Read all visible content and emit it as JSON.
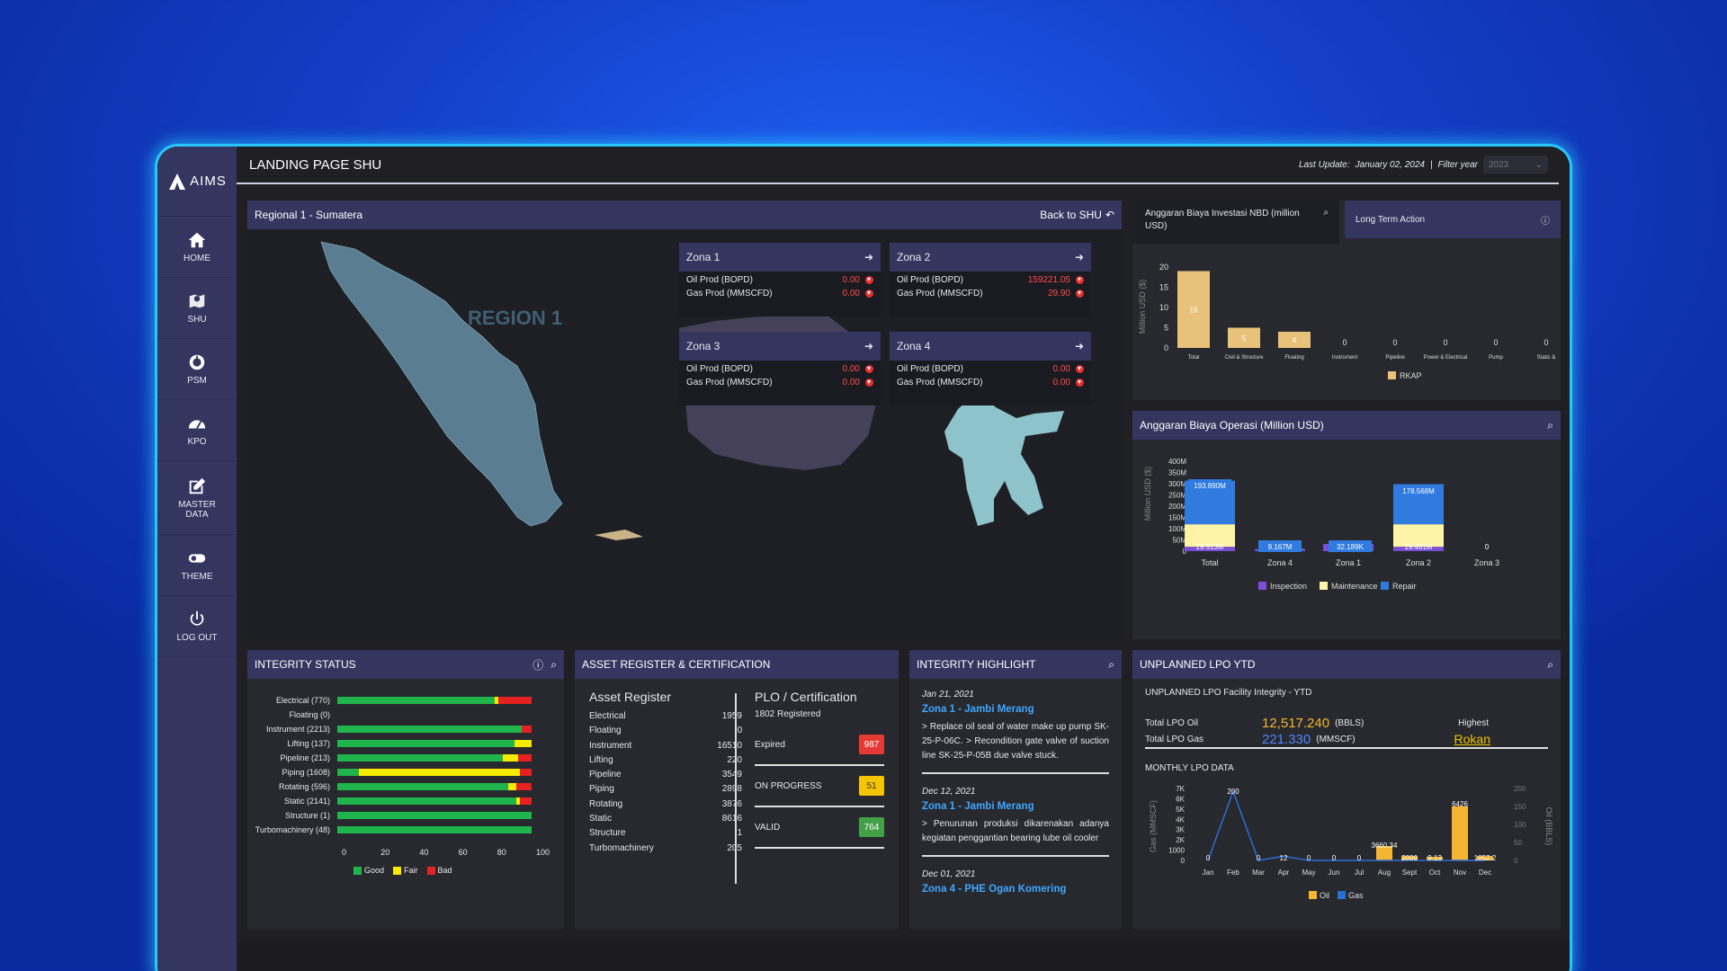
{
  "app": {
    "logo_text": "AIMS",
    "page_title": "LANDING PAGE SHU",
    "last_update_label": "Last Update:",
    "last_update_value": "January 02, 2024",
    "separator": "|",
    "filter_label": "Filter year",
    "filter_value": "2023"
  },
  "sidebar": {
    "items": [
      {
        "label": "HOME",
        "icon": "home-icon"
      },
      {
        "label": "SHU",
        "icon": "map-pin-icon"
      },
      {
        "label": "PSM",
        "icon": "dashboard-icon"
      },
      {
        "label": "KPO",
        "icon": "gauge-icon"
      },
      {
        "label": "MASTER DATA",
        "icon": "edit-icon"
      },
      {
        "label": "THEME",
        "icon": "toggle-icon"
      },
      {
        "label": "LOG OUT",
        "icon": "power-icon"
      }
    ]
  },
  "map": {
    "header": "Regional 1 - Sumatera",
    "back_label": "Back to SHU",
    "region_label": "REGION 1",
    "zones": [
      {
        "name": "Zona 1",
        "oil_label": "Oil Prod (BOPD)",
        "oil": "0.00",
        "gas_label": "Gas Prod (MMSCFD)",
        "gas": "0.00"
      },
      {
        "name": "Zona 2",
        "oil_label": "Oil Prod (BOPD)",
        "oil": "159221.05",
        "gas_label": "Gas Prod (MMSCFD)",
        "gas": "29.90"
      },
      {
        "name": "Zona 3",
        "oil_label": "Oil Prod (BOPD)",
        "oil": "0.00",
        "gas_label": "Gas Prod (MMSCFD)",
        "gas": "0.00"
      },
      {
        "name": "Zona 4",
        "oil_label": "Oil Prod (BOPD)",
        "oil": "0.00",
        "gas_label": "Gas Prod (MMSCFD)",
        "gas": "0.00"
      }
    ]
  },
  "invest": {
    "title": "Anggaran Biaya Investasi NBD (million USD)",
    "long_term": "Long Term Action"
  },
  "ops": {
    "title": "Anggaran Biaya Operasi (Million USD)"
  },
  "integrity": {
    "title": "INTEGRITY STATUS",
    "legend": [
      "Good",
      "Fair",
      "Bad"
    ],
    "ticks": [
      "0",
      "20",
      "40",
      "60",
      "80",
      "100"
    ],
    "rows": [
      {
        "label": "Electrical (770)",
        "good": 81,
        "fair": 2,
        "bad": 17
      },
      {
        "label": "Floating (0)",
        "good": 0,
        "fair": 0,
        "bad": 0
      },
      {
        "label": "Instrument (2213)",
        "good": 95,
        "fair": 0,
        "bad": 5
      },
      {
        "label": "Lifting (137)",
        "good": 91,
        "fair": 9,
        "bad": 0
      },
      {
        "label": "Pipeline (213)",
        "good": 85,
        "fair": 8,
        "bad": 7
      },
      {
        "label": "Piping (1608)",
        "good": 11,
        "fair": 83,
        "bad": 6
      },
      {
        "label": "Rotating (596)",
        "good": 88,
        "fair": 4,
        "bad": 8
      },
      {
        "label": "Static (2141)",
        "good": 92,
        "fair": 2,
        "bad": 6
      },
      {
        "label": "Structure (1)",
        "good": 100,
        "fair": 0,
        "bad": 0
      },
      {
        "label": "Turbomachinery (48)",
        "good": 100,
        "fair": 0,
        "bad": 0
      }
    ]
  },
  "asset": {
    "title": "ASSET REGISTER & CERTIFICATION",
    "register_title": "Asset Register",
    "rows": [
      [
        "Electrical",
        "1959"
      ],
      [
        "Floating",
        "0"
      ],
      [
        "Instrument",
        "16510"
      ],
      [
        "Lifting",
        "220"
      ],
      [
        "Pipeline",
        "3549"
      ],
      [
        "Piping",
        "2898"
      ],
      [
        "Rotating",
        "3876"
      ],
      [
        "Static",
        "8616"
      ],
      [
        "Structure",
        "1"
      ],
      [
        "Turbomachinery",
        "205"
      ]
    ],
    "plo_title": "PLO / Certification",
    "registered": "1802 Registered",
    "cert": [
      {
        "label": "Expired",
        "value": "987",
        "color": "#e53935"
      },
      {
        "label": "ON PROGRESS",
        "value": "51",
        "color": "#f5c400"
      },
      {
        "label": "VALID",
        "value": "764",
        "color": "#43a047"
      }
    ]
  },
  "highlight": {
    "title": "INTEGRITY HIGHLIGHT",
    "items": [
      {
        "date": "Jan 21, 2021",
        "zone": "Zona 1 - Jambi Merang",
        "text": "> Replace oil seal of water make up pump SK-25-P-06C. > Recondition gate valve of suction line SK-25-P-05B due valve stuck."
      },
      {
        "date": "Dec 12, 2021",
        "zone": "Zona 1 - Jambi Merang",
        "text": "> Penurunan produksi dikarenakan adanya kegiatan penggantian bearing lube oil cooler"
      },
      {
        "date": "Dec 01, 2021",
        "zone": "Zona 4 - PHE Ogan Komering",
        "text": ""
      }
    ]
  },
  "lpo": {
    "title": "UNPLANNED LPO YTD",
    "subtitle": "UNPLANNED LPO Facility Integrity - YTD",
    "oil_label": "Total LPO Oil",
    "oil_value": "12,517.240",
    "oil_unit": "(BBLS)",
    "gas_label": "Total LPO Gas",
    "gas_value": "221.330",
    "gas_unit": "(MMSCF)",
    "highest_label": "Highest",
    "highest_value": "Rokan",
    "monthly_title": "MONTHLY LPO DATA"
  },
  "chart_data": [
    {
      "type": "bar",
      "title": "Anggaran Biaya Investasi NBD (million USD)",
      "ylabel": "Million USD ($)",
      "categories": [
        "Total",
        "Civil & Structure",
        "Floating",
        "Instrument",
        "Pipeline",
        "Power & Electrical",
        "Pump",
        "Static &"
      ],
      "series": [
        {
          "name": "RKAP",
          "values": [
            19,
            5,
            4,
            0,
            0,
            0,
            0,
            0
          ]
        }
      ],
      "ylim": [
        0,
        20
      ],
      "yticks": [
        "0",
        "5",
        "10",
        "15",
        "20"
      ],
      "color": "#e8c27a"
    },
    {
      "type": "bar",
      "stacked": true,
      "title": "Anggaran Biaya Operasi (Million USD)",
      "ylabel": "Million USD ($)",
      "categories": [
        "Total",
        "Zona 4",
        "Zona 1",
        "Zona 2",
        "Zona 3"
      ],
      "series": [
        {
          "name": "Inspection",
          "values": [
            19.513,
            9.167,
            32.189,
            19.481,
            0
          ],
          "color": "#7a4fd6"
        },
        {
          "name": "Maintenance",
          "values": [
            100,
            0,
            0,
            100,
            0
          ],
          "color": "#fff3a8"
        },
        {
          "name": "Repair",
          "values": [
            193.89,
            0,
            0,
            178.568,
            0
          ],
          "color": "#2f7be0"
        }
      ],
      "labels": [
        "193.890M",
        "9.167M",
        "32.189K",
        "178.568M",
        "0",
        "19.513M",
        "19.481M"
      ],
      "yticks": [
        "0",
        "50M",
        "100M",
        "150M",
        "200M",
        "250M",
        "300M",
        "350M",
        "400M"
      ],
      "ylim": [
        0,
        400
      ]
    },
    {
      "type": "bar+line",
      "title": "MONTHLY LPO DATA",
      "categories": [
        "Jan",
        "Feb",
        "Mar",
        "Apr",
        "May",
        "Jun",
        "Jul",
        "Aug",
        "Sept",
        "Oct",
        "Nov",
        "Dec"
      ],
      "series": [
        {
          "name": "Oil",
          "axis": "Oil (BBLS)",
          "values": [
            0,
            0,
            0,
            0,
            0,
            0,
            0,
            40,
            12,
            10,
            150,
            12
          ],
          "color": "#f5b531"
        },
        {
          "name": "Gas",
          "axis": "Gas (MMSCF)",
          "values": [
            0,
            200,
            0,
            12,
            0,
            0,
            0,
            0,
            0,
            0,
            0,
            0
          ],
          "color": "#2a6fd6"
        }
      ],
      "left_ticks": [
        "0",
        "1000",
        "2K",
        "3K",
        "4K",
        "5K",
        "6K",
        "7K"
      ],
      "right_ticks": [
        "0",
        "50",
        "100",
        "150",
        "200"
      ],
      "left_label": "Gas (MMSCF)",
      "right_label": "Oil (BBLS)",
      "point_labels": [
        "0",
        "200",
        "0",
        "12",
        "0",
        "0",
        "0",
        "3660.34",
        "2000",
        "9.13",
        "6426",
        "1052.2"
      ]
    }
  ]
}
